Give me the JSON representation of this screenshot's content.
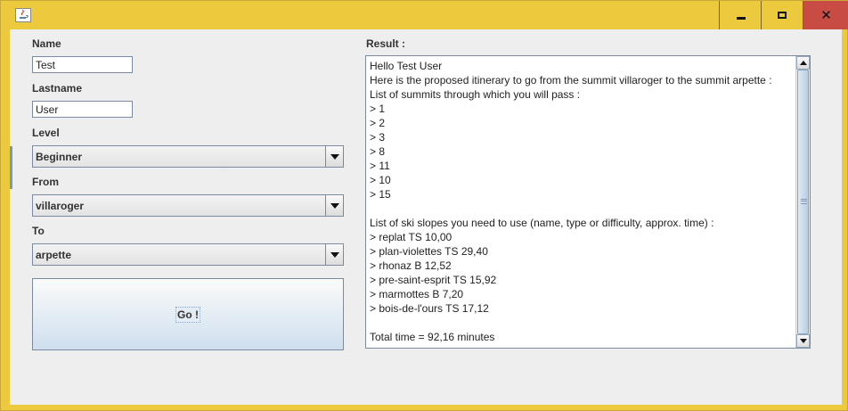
{
  "window": {
    "minimize_glyph": "minimize",
    "maximize_glyph": "maximize",
    "close_glyph": "✕",
    "close_color": "#c94c44",
    "frame_color": "#edc93e"
  },
  "form": {
    "name_label": "Name",
    "name_value": "Test",
    "lastname_label": "Lastname",
    "lastname_value": "User",
    "level_label": "Level",
    "level_value": "Beginner",
    "from_label": "From",
    "from_value": "villaroger",
    "to_label": "To",
    "to_value": "arpette",
    "go_label": "Go !"
  },
  "result": {
    "label": "Result :",
    "lines": [
      "Hello Test User",
      "Here is the proposed itinerary to go from the summit villaroger to the summit arpette :",
      "List of summits through which you will pass :",
      "> 1",
      "> 2",
      "> 3",
      "> 8",
      "> 11",
      "> 10",
      "> 15",
      "",
      "List of ski slopes you need to use (name, type or difficulty, approx. time) :",
      "> replat TS 10,00",
      "> plan-violettes TS 29,40",
      "> rhonaz B 12,52",
      "> pre-saint-esprit TS 15,92",
      "> marmottes B 7,20",
      "> bois-de-l'ours TS 17,12",
      "",
      "Total time = 92,16 minutes"
    ]
  }
}
